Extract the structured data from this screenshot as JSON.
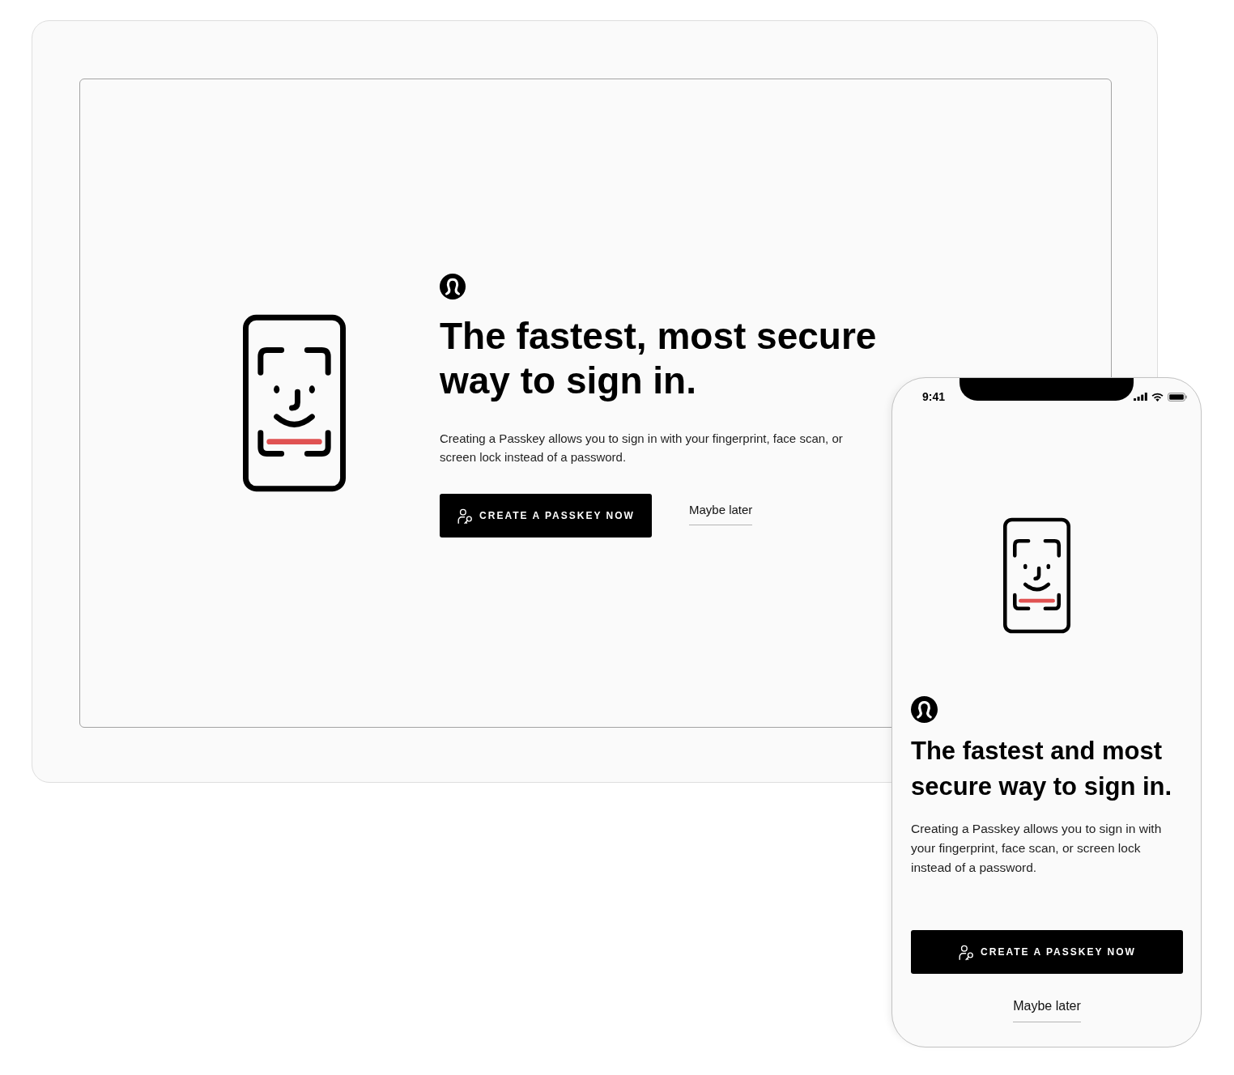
{
  "desktop": {
    "heading": "The fastest, most secure way to sign in.",
    "body": "Creating a Passkey allows you to sign in with your fingerprint, face scan, or screen lock instead of a password.",
    "primary_button": "CREATE A PASSKEY NOW",
    "secondary_link": "Maybe later"
  },
  "mobile": {
    "status_bar": {
      "time": "9:41"
    },
    "heading": "The fastest and most secure way to sign in.",
    "body": "Creating a Passkey allows you to sign in with your fingerprint, face scan, or screen lock instead of a password.",
    "primary_button": "CREATE A PASSKEY NOW",
    "secondary_link": "Maybe later"
  }
}
